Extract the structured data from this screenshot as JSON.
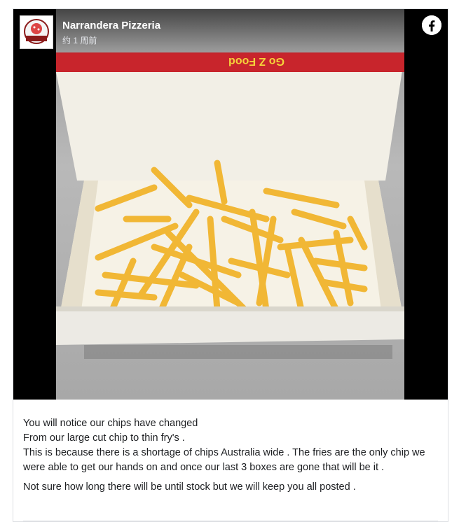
{
  "post": {
    "page_name": "Narrandera Pizzeria",
    "timestamp": "约 1 周前",
    "avatar_text": "PIZZERIA",
    "box_print": "Go Z Food",
    "caption_lines": [
      "You will notice our chips have changed",
      "From our large cut chip to thin fry's .",
      "This is because there is a shortage of chips Australia wide . The fries are the only chip we were able to get our hands on and once our last 3 boxes are gone that will be it .",
      "Not sure how long there will be until stock but we will keep you all posted ."
    ]
  },
  "icons": {
    "facebook": "facebook-icon"
  },
  "colors": {
    "media_bg": "#000000",
    "text": "#1c1e21",
    "box_red": "#d2232a",
    "fries": "#f2b531"
  }
}
